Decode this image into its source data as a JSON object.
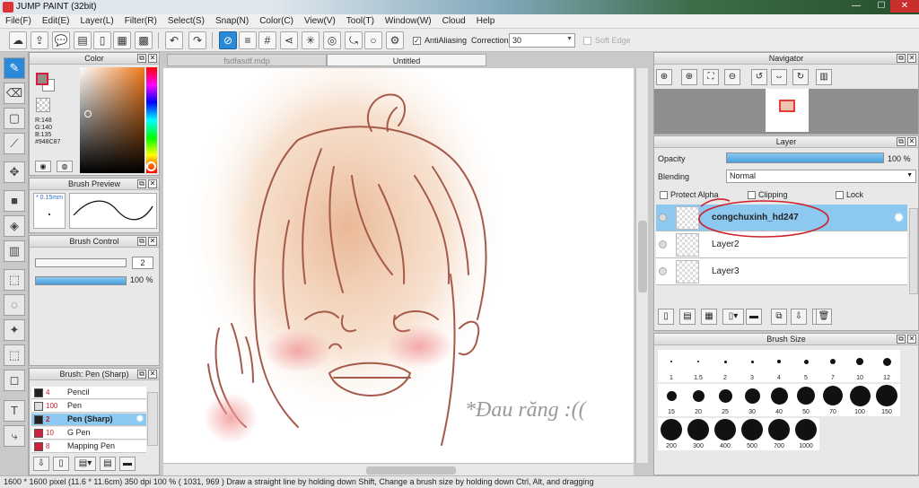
{
  "window": {
    "title": "JUMP PAINT (32bit)"
  },
  "menu": [
    "File(F)",
    "Edit(E)",
    "Layer(L)",
    "Filter(R)",
    "Select(S)",
    "Snap(N)",
    "Color(C)",
    "View(V)",
    "Tool(T)",
    "Window(W)",
    "Cloud",
    "Help"
  ],
  "toolbar": {
    "antialiasing_label": "AntiAliasing",
    "correction_label": "Correction",
    "correction_value": "30",
    "soft_edge_label": "Soft Edge"
  },
  "color_panel": {
    "title": "Color",
    "fg_color": "#948C87",
    "values": [
      "R:148",
      "G:140",
      "B:135",
      "#948C87"
    ]
  },
  "brush_preview": {
    "title": "Brush Preview",
    "size_label": "* 0.15mm"
  },
  "brush_control": {
    "title": "Brush Control",
    "size_value": "2",
    "opacity_value": "100 %",
    "opacity_percent": 100
  },
  "brush_list": {
    "title": "Brush: Pen (Sharp)",
    "items": [
      {
        "num": "4",
        "name": "Pencil",
        "color": "#222222"
      },
      {
        "num": "100",
        "name": "Pen",
        "color": "#dddddd"
      },
      {
        "num": "2",
        "name": "Pen (Sharp)",
        "color": "#222222",
        "selected": true
      },
      {
        "num": "10",
        "name": "G Pen",
        "color": "#d21f3c"
      },
      {
        "num": "8",
        "name": "Mapping Pen",
        "color": "#d21f3c"
      }
    ]
  },
  "documents": {
    "tabs": [
      "fsdfasdf.mdp",
      "Untitled"
    ],
    "active": 1
  },
  "canvas": {
    "caption": "*Đau răng :(("
  },
  "navigator": {
    "title": "Navigator"
  },
  "layer_panel": {
    "title": "Layer",
    "opacity_label": "Opacity",
    "opacity_value": "100 %",
    "blending_label": "Blending",
    "blending_value": "Normal",
    "protect_alpha": "Protect Alpha",
    "clipping": "Clipping",
    "lock": "Lock",
    "layers": [
      {
        "name": "congchuxinh_hd247",
        "selected": true
      },
      {
        "name": "Layer2"
      },
      {
        "name": "Layer3"
      }
    ]
  },
  "brush_size": {
    "title": "Brush Size",
    "sizes": [
      "1",
      "1.5",
      "2",
      "3",
      "4",
      "5",
      "7",
      "10",
      "12",
      "15",
      "20",
      "25",
      "30",
      "40",
      "50",
      "70",
      "100",
      "150",
      "200",
      "300",
      "400",
      "500",
      "700",
      "1000"
    ]
  },
  "status": {
    "text": "1600 * 1600 pixel   (11.6 * 11.6cm)   350 dpi   100 %   ( 1031, 969 )   Draw a straight line by holding down Shift, Change a brush size by holding down Ctrl, Alt, and dragging"
  },
  "colors": {
    "accent": "#2a8ad8",
    "selection": "#8cc8f0",
    "line_art": "#a55a4a"
  }
}
